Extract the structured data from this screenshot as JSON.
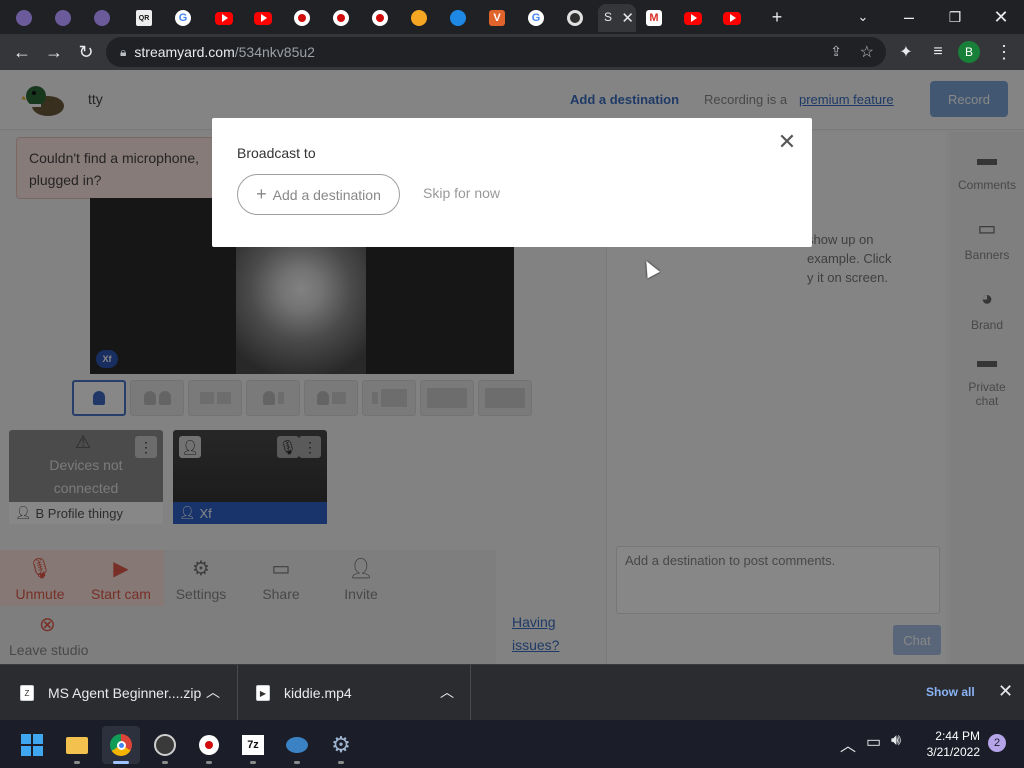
{
  "browser": {
    "tabs": [
      {
        "icon": "owl-icon"
      },
      {
        "icon": "owl-icon"
      },
      {
        "icon": "owl-icon"
      },
      {
        "icon": "qr-icon",
        "text": "QR"
      },
      {
        "icon": "google-icon",
        "text": "G"
      },
      {
        "icon": "youtube-icon"
      },
      {
        "icon": "youtube-icon"
      },
      {
        "icon": "record-icon"
      },
      {
        "icon": "record-icon"
      },
      {
        "icon": "record-icon"
      },
      {
        "icon": "puzzle-color-icon"
      },
      {
        "icon": "blue-app-icon"
      },
      {
        "icon": "v-app-icon",
        "text": "V"
      },
      {
        "icon": "google-icon",
        "text": "G"
      },
      {
        "icon": "chrome-icon"
      },
      {
        "icon": "streamyard-icon",
        "text": "S",
        "active": true
      },
      {
        "icon": "gmail-icon",
        "text": "M"
      },
      {
        "icon": "youtube-icon"
      },
      {
        "icon": "youtube-icon"
      }
    ],
    "new_tab": "+",
    "url_host": "streamyard.com",
    "url_path": "/534nkv85u2",
    "profile_initial": "B"
  },
  "app": {
    "studio_name": "tty",
    "add_destination_link": "Add a destination",
    "recording_text": "Recording is a",
    "premium_link": "premium feature",
    "record_button": "Record",
    "warning_line1": "Couldn't find a microphone,",
    "warning_line2": "plugged in?",
    "stage_tag": "Xf",
    "tile1_line1": "Devices not",
    "tile1_line2": "connected",
    "tile1_name": "B Profile thingy",
    "tile2_name": "Xf",
    "controls": {
      "unmute": "Unmute",
      "start_cam": "Start cam",
      "settings": "Settings",
      "share": "Share",
      "invite": "Invite",
      "leave": "Leave studio"
    },
    "having_issues_1": "Having",
    "having_issues_2": "issues?",
    "right_info_1": "show up on",
    "right_info_2": "example. Click",
    "right_info_3": "y it on screen.",
    "comment_placeholder": "Add a destination to post comments.",
    "chat_button": "Chat",
    "rail": {
      "comments": "Comments",
      "banners": "Banners",
      "brand": "Brand",
      "private_chat_1": "Private",
      "private_chat_2": "chat"
    }
  },
  "modal": {
    "title": "Broadcast to",
    "add_destination": "Add a destination",
    "skip": "Skip for now"
  },
  "downloads": {
    "item1": "MS Agent Beginner....zip",
    "item2": "kiddie.mp4",
    "show_all": "Show all"
  },
  "taskbar": {
    "time": "2:44 PM",
    "date": "3/21/2022",
    "notifications": "2"
  }
}
